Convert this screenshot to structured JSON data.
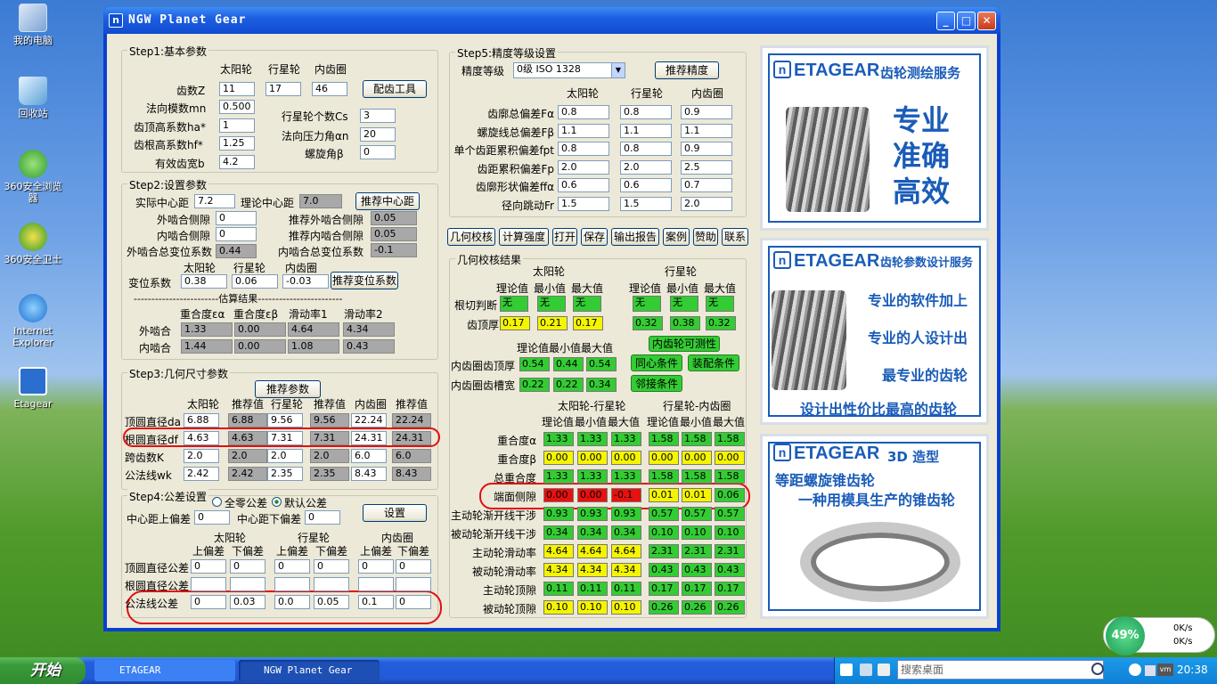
{
  "desktop": {
    "icons": [
      "我的电脑",
      "回收站",
      "360安全浏览器",
      "360安全卫士",
      "Internet Explorer",
      "Etagear"
    ]
  },
  "window": {
    "title": "NGW Planet Gear",
    "min": "_",
    "max": "□",
    "close": "✕"
  },
  "step1": {
    "title": "Step1:基本参数",
    "col_sun": "太阳轮",
    "col_planet": "行星轮",
    "col_ring": "内齿圈",
    "teeth_label": "齿数Z",
    "teeth": [
      "11",
      "17",
      "46"
    ],
    "gear_tool_btn": "配齿工具",
    "module_label": "法向模数mn",
    "module": "0.500",
    "addendum_label": "齿顶高系数ha*",
    "addendum": "1",
    "dedendum_label": "齿根高系数hf*",
    "dedendum": "1.25",
    "width_label": "有效齿宽b",
    "width": "4.2",
    "planets_label": "行星轮个数Cs",
    "planets": "3",
    "pressure_label": "法向压力角αn",
    "pressure": "20",
    "helix_label": "螺旋角β",
    "helix": "0"
  },
  "step2": {
    "title": "Step2:设置参数",
    "center_label": "实际中心距",
    "center": "7.2",
    "theory_label": "理论中心距",
    "theory": "7.0",
    "rec_center_btn": "推荐中心距",
    "ext_bl_label": "外啮合侧隙",
    "ext_bl": "0",
    "rec_ext_bl_label": "推荐外啮合侧隙",
    "rec_ext_bl": "0.05",
    "int_bl_label": "内啮合侧隙",
    "int_bl": "0",
    "rec_int_bl_label": "推荐内啮合侧隙",
    "rec_int_bl": "0.05",
    "ext_shift_label": "外啮合总变位系数",
    "ext_shift": "0.44",
    "int_shift_label": "内啮合总变位系数",
    "int_shift": "-0.1",
    "col_sun": "太阳轮",
    "col_planet": "行星轮",
    "col_ring": "内齿圈",
    "shift_label": "变位系数",
    "shift": [
      "0.38",
      "0.06",
      "-0.03"
    ],
    "rec_shift_btn": "推荐变位系数",
    "est_title": "------------------------估算结果------------------------",
    "est_cols": [
      "重合度εα",
      "重合度εβ",
      "滑动率1",
      "滑动率2"
    ],
    "ext_label": "外啮合",
    "ext_vals": [
      "1.33",
      "0.00",
      "4.64",
      "4.34"
    ],
    "int_label": "内啮合",
    "int_vals": [
      "1.44",
      "0.00",
      "1.08",
      "0.43"
    ]
  },
  "step3": {
    "title": "Step3:几何尺寸参数",
    "rec_btn": "推荐参数",
    "cols": [
      "太阳轮",
      "推荐值",
      "行星轮",
      "推荐值",
      "内齿圈",
      "推荐值"
    ],
    "rows": [
      {
        "label": "顶圆直径da",
        "vals": [
          "6.88",
          "6.88",
          "9.56",
          "9.56",
          "22.24",
          "22.24"
        ]
      },
      {
        "label": "根圆直径df",
        "vals": [
          "4.63",
          "4.63",
          "7.31",
          "7.31",
          "24.31",
          "24.31"
        ]
      },
      {
        "label": "跨齿数K",
        "vals": [
          "2.0",
          "2.0",
          "2.0",
          "2.0",
          "6.0",
          "6.0"
        ]
      },
      {
        "label": "公法线wk",
        "vals": [
          "2.42",
          "2.42",
          "2.35",
          "2.35",
          "8.43",
          "8.43"
        ]
      }
    ]
  },
  "step4": {
    "title": "Step4:公差设置",
    "opt_zero": "全零公差",
    "opt_default": "默认公差",
    "set_btn": "设置",
    "cd_up_label": "中心距上偏差",
    "cd_up": "0",
    "cd_low_label": "中心距下偏差",
    "cd_low": "0",
    "col_sun": "太阳轮",
    "col_planet": "行星轮",
    "col_ring": "内齿圈",
    "up": "上偏差",
    "low": "下偏差",
    "rows": [
      {
        "label": "顶圆直径公差",
        "vals": [
          "0",
          "0",
          "0",
          "0",
          "0",
          "0"
        ]
      },
      {
        "label": "根圆直径公差",
        "vals": [
          "",
          "",
          "",
          "",
          "",
          ""
        ]
      },
      {
        "label": "公法线公差",
        "vals": [
          "0",
          "0.03",
          "0.0",
          "0.05",
          "0.1",
          "0"
        ]
      }
    ]
  },
  "step5": {
    "title": "Step5:精度等级设置",
    "grade_label": "精度等级",
    "grade": "0级 ISO 1328",
    "rec_btn": "推荐精度",
    "cols": [
      "太阳轮",
      "行星轮",
      "内齿圈"
    ],
    "rows": [
      {
        "label": "齿廓总偏差Fα",
        "vals": [
          "0.8",
          "0.8",
          "0.9"
        ]
      },
      {
        "label": "螺旋线总偏差Fβ",
        "vals": [
          "1.1",
          "1.1",
          "1.1"
        ]
      },
      {
        "label": "单个齿距累积偏差fpt",
        "vals": [
          "0.8",
          "0.8",
          "0.9"
        ]
      },
      {
        "label": "齿距累积偏差Fp",
        "vals": [
          "2.0",
          "2.0",
          "2.5"
        ]
      },
      {
        "label": "齿廓形状偏差ffα",
        "vals": [
          "0.6",
          "0.6",
          "0.7"
        ]
      },
      {
        "label": "径向跳动Fr",
        "vals": [
          "1.5",
          "1.5",
          "2.0"
        ]
      }
    ]
  },
  "actions": [
    "几何校核",
    "计算强度",
    "打开",
    "保存",
    "输出报告",
    "案例",
    "赞助",
    "联系"
  ],
  "results": {
    "title": "几何校核结果",
    "col_sun": "太阳轮",
    "col_planet": "行星轮",
    "sub": [
      "理论值",
      "最小值",
      "最大值"
    ],
    "undercut_label": "根切判断",
    "undercut_sun": [
      "无",
      "无",
      "无"
    ],
    "undercut_planet": [
      "无",
      "无",
      "无"
    ],
    "tip_label": "齿顶厚",
    "tip_sun": [
      "0.17",
      "0.21",
      "0.17"
    ],
    "tip_planet": [
      "0.32",
      "0.38",
      "0.32"
    ],
    "ring_cols": "理论值最小值最大值",
    "ring_measure_btn": "内齿轮可测性",
    "ring_tip_label": "内齿圈齿顶厚",
    "ring_tip": [
      "0.54",
      "0.44",
      "0.54"
    ],
    "ring_gap_label": "内齿圈齿槽宽",
    "ring_gap": [
      "0.22",
      "0.22",
      "0.34"
    ],
    "concentric_btn": "同心条件",
    "assembly_btn": "装配条件",
    "adjacent_btn": "邻接条件",
    "mesh1": "太阳轮-行星轮",
    "mesh2": "行星轮-内齿圈",
    "mrows": [
      {
        "label": "重合度α",
        "a": [
          "1.33",
          "1.33",
          "1.33"
        ],
        "b": [
          "1.58",
          "1.58",
          "1.58"
        ],
        "ca": [
          "g",
          "g",
          "g"
        ],
        "cb": [
          "g",
          "g",
          "g"
        ]
      },
      {
        "label": "重合度β",
        "a": [
          "0.00",
          "0.00",
          "0.00"
        ],
        "b": [
          "0.00",
          "0.00",
          "0.00"
        ],
        "ca": [
          "y",
          "y",
          "y"
        ],
        "cb": [
          "y",
          "y",
          "y"
        ]
      },
      {
        "label": "总重合度",
        "a": [
          "1.33",
          "1.33",
          "1.33"
        ],
        "b": [
          "1.58",
          "1.58",
          "1.58"
        ],
        "ca": [
          "g",
          "g",
          "g"
        ],
        "cb": [
          "g",
          "g",
          "g"
        ]
      },
      {
        "label": "端面侧隙",
        "a": [
          "0.00",
          "0.00",
          "-0.1"
        ],
        "b": [
          "0.01",
          "0.01",
          "0.06"
        ],
        "ca": [
          "r",
          "r",
          "r"
        ],
        "cb": [
          "y",
          "y",
          "g"
        ]
      },
      {
        "label": "主动轮渐开线干涉",
        "a": [
          "0.93",
          "0.93",
          "0.93"
        ],
        "b": [
          "0.57",
          "0.57",
          "0.57"
        ],
        "ca": [
          "g",
          "g",
          "g"
        ],
        "cb": [
          "g",
          "g",
          "g"
        ]
      },
      {
        "label": "被动轮渐开线干涉",
        "a": [
          "0.34",
          "0.34",
          "0.34"
        ],
        "b": [
          "0.10",
          "0.10",
          "0.10"
        ],
        "ca": [
          "g",
          "g",
          "g"
        ],
        "cb": [
          "g",
          "g",
          "g"
        ]
      },
      {
        "label": "主动轮滑动率",
        "a": [
          "4.64",
          "4.64",
          "4.64"
        ],
        "b": [
          "2.31",
          "2.31",
          "2.31"
        ],
        "ca": [
          "y",
          "y",
          "y"
        ],
        "cb": [
          "g",
          "g",
          "g"
        ]
      },
      {
        "label": "被动轮滑动率",
        "a": [
          "4.34",
          "4.34",
          "4.34"
        ],
        "b": [
          "0.43",
          "0.43",
          "0.43"
        ],
        "ca": [
          "y",
          "y",
          "y"
        ],
        "cb": [
          "g",
          "g",
          "g"
        ]
      },
      {
        "label": "主动轮顶隙",
        "a": [
          "0.11",
          "0.11",
          "0.11"
        ],
        "b": [
          "0.17",
          "0.17",
          "0.17"
        ],
        "ca": [
          "g",
          "g",
          "g"
        ],
        "cb": [
          "g",
          "g",
          "g"
        ]
      },
      {
        "label": "被动轮顶隙",
        "a": [
          "0.10",
          "0.10",
          "0.10"
        ],
        "b": [
          "0.26",
          "0.26",
          "0.26"
        ],
        "ca": [
          "y",
          "y",
          "y"
        ],
        "cb": [
          "g",
          "g",
          "g"
        ]
      }
    ]
  },
  "ads": {
    "logo": "ETAGEAR",
    "ad1": {
      "tag": "齿轮测绘服务",
      "lines": [
        "专业",
        "准确",
        "高效"
      ]
    },
    "ad2": {
      "tag": "齿轮参数设计服务",
      "lines": [
        "专业的软件加上",
        "专业的人设计出",
        "最专业的齿轮",
        "设计出性价比最高的齿轮"
      ]
    },
    "ad3": {
      "tag": "3D 造型",
      "lines": [
        "等距螺旋锥齿轮",
        "一种用模具生产的锥齿轮"
      ]
    }
  },
  "taskbar": {
    "start": "开始",
    "tasks": [
      "ETAGEAR",
      "NGW Planet Gear"
    ],
    "search": "搜索桌面",
    "time": "20:38",
    "net_pct": "49%",
    "up": "0K/s",
    "down": "0K/s"
  }
}
